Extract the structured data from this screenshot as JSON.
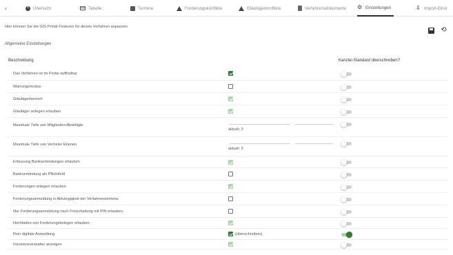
{
  "tabs": [
    {
      "label": "",
      "icon": "back-icon",
      "active": false
    },
    {
      "label": "Übersicht",
      "icon": "info-icon",
      "active": false
    },
    {
      "label": "Tabelle",
      "icon": "table-icon",
      "active": false
    },
    {
      "label": "Termine",
      "icon": "calendar-icon",
      "active": false
    },
    {
      "label": "Forderungskonflikte",
      "icon": "warning-icon",
      "active": false
    },
    {
      "label": "Gläubigerkonflikte",
      "icon": "warning-icon",
      "active": false
    },
    {
      "label": "Verfahrensdokumente",
      "icon": "document-icon",
      "active": false
    },
    {
      "label": "Einstellungen",
      "icon": "gear-icon",
      "active": true
    },
    {
      "label": "Import-Einst",
      "icon": "import-icon",
      "active": false
    }
  ],
  "page": {
    "intro": "Hier können Sie die GIS-Portal-Features für dieses Verfahren anpassen.",
    "section_title": "Allgemeine Einstellungen",
    "col_description": "Beschreibung",
    "col_override": "Kanzlei-Standard überschreiben?",
    "save_icon": "save-icon",
    "reset_icon": "history-icon"
  },
  "settings": [
    {
      "label": "Das Verfahren ist im Portal auffindbar",
      "control": "checkbox",
      "checked": true,
      "disabled": false,
      "note": "",
      "toggle": false
    },
    {
      "label": "Wartungsmodus",
      "control": "checkbox",
      "checked": false,
      "disabled": false,
      "note": "",
      "toggle": false
    },
    {
      "label": "Gläubigerbereich",
      "control": "checkbox",
      "checked": true,
      "disabled": true,
      "note": "",
      "toggle": false
    },
    {
      "label": "Gläubiger anlegen erlauben",
      "control": "checkbox",
      "checked": true,
      "disabled": true,
      "note": "",
      "toggle": false
    },
    {
      "label": "Maximale Tiefe von Mitgliedern/Beteiligte",
      "control": "slider",
      "note": "aktuell: 3",
      "toggle": false
    },
    {
      "label": "Maximale Tiefe von Vertreter Ebenen",
      "control": "slider",
      "note": "aktuell: 3",
      "toggle": false
    },
    {
      "label": "Erfassung Bankverbindungen erlauben",
      "control": "checkbox",
      "checked": true,
      "disabled": true,
      "note": "",
      "toggle": false
    },
    {
      "label": "Bankverbindung als Pflichtfeld",
      "control": "checkbox",
      "checked": false,
      "disabled": false,
      "note": "",
      "toggle": false
    },
    {
      "label": "Forderungen anlegen erlauben",
      "control": "checkbox",
      "checked": true,
      "disabled": true,
      "note": "",
      "toggle": false
    },
    {
      "label": "Forderungsanmeldung in Abhängigkeit der Verfahrenstermine",
      "control": "checkbox",
      "checked": false,
      "disabled": false,
      "note": "",
      "toggle": false
    },
    {
      "label": "Nur Forderungsanmeldung nach Freischaltung mit PIN erlauben.",
      "control": "checkbox",
      "checked": false,
      "disabled": false,
      "note": "",
      "toggle": false
    },
    {
      "label": "Hochladen von Forderungsbelegen erlauben",
      "control": "checkbox",
      "checked": true,
      "disabled": true,
      "note": "",
      "toggle": false
    },
    {
      "label": "Rein digitale Anmeldung",
      "control": "checkbox",
      "checked": true,
      "disabled": false,
      "note": "(überschreiben)",
      "toggle": true
    },
    {
      "label": "Insolvenzverwalter anzeigen",
      "control": "checkbox",
      "checked": true,
      "disabled": true,
      "note": "",
      "toggle": false
    }
  ]
}
